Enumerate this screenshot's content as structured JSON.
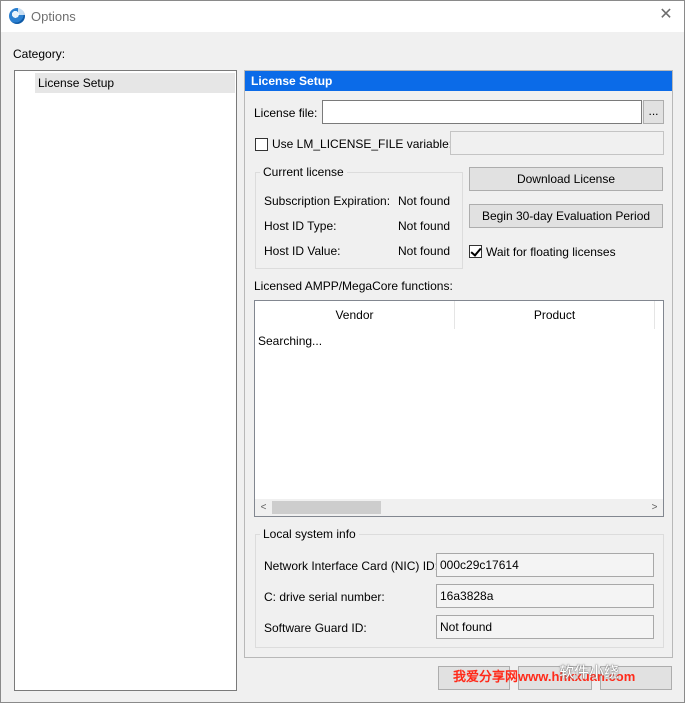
{
  "window": {
    "title": "Options",
    "close_glyph": "✕"
  },
  "category": {
    "label": "Category:",
    "items": [
      {
        "label": "License Setup",
        "selected": true
      }
    ]
  },
  "panel": {
    "header": "License Setup",
    "license_file": {
      "label": "License file:",
      "value": "",
      "browse_label": "..."
    },
    "lm_license": {
      "label": "Use LM_LICENSE_FILE variable:",
      "checked": false,
      "value": ""
    },
    "current_license": {
      "title": "Current license",
      "rows": [
        {
          "label": "Subscription Expiration:",
          "value": "Not found"
        },
        {
          "label": "Host ID Type:",
          "value": "Not found"
        },
        {
          "label": "Host ID Value:",
          "value": "Not found"
        }
      ]
    },
    "buttons": {
      "download": "Download License",
      "evaluation": "Begin 30-day Evaluation Period"
    },
    "floating": {
      "label": "Wait for floating licenses",
      "checked": true
    },
    "functions": {
      "label": "Licensed AMPP/MegaCore functions:",
      "columns": [
        "Vendor",
        "Product"
      ],
      "status": "Searching...",
      "scroll_left": "<",
      "scroll_right": ">"
    },
    "local_system": {
      "title": "Local system info",
      "rows": [
        {
          "label": "Network Interface Card (NIC) ID:",
          "value": "000c29c17614"
        },
        {
          "label": "C: drive serial number:",
          "value": "16a3828a"
        },
        {
          "label": "Software Guard ID:",
          "value": "Not found"
        }
      ]
    }
  },
  "watermark": {
    "text": "我爱分享网www.hhkxuan.com",
    "logo": "软件小绕"
  },
  "colors": {
    "accent": "#0b6be8",
    "watermark": "#ff2a1a"
  }
}
